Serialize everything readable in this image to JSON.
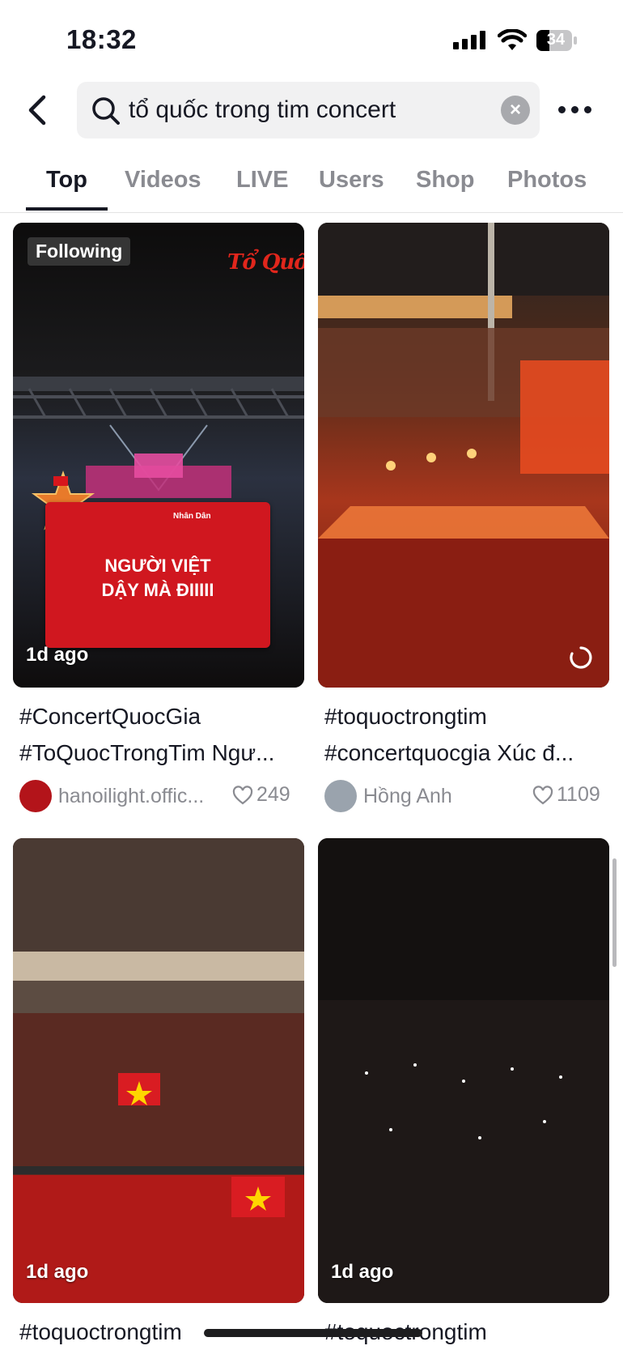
{
  "status_bar": {
    "time": "18:32",
    "battery": "34"
  },
  "search": {
    "query": "tổ quốc trong tim concert"
  },
  "tabs": [
    {
      "label": "Top"
    },
    {
      "label": "Videos"
    },
    {
      "label": "LIVE"
    },
    {
      "label": "Users"
    },
    {
      "label": "Shop"
    },
    {
      "label": "Photos"
    }
  ],
  "results": [
    {
      "badge": "Following",
      "overlay_logo": "Tổ Quốc",
      "card_line1": "NGƯỜI VIỆT",
      "card_line2": "DẬY MÀ ĐIIIII",
      "card_brand": "Nhân Dân",
      "age": "1d ago",
      "caption_line1": "#ConcertQuocGia",
      "caption_line2": "#ToQuocTrongTim Ngư...",
      "author": "hanoilight.offic...",
      "likes": "249"
    },
    {
      "age": "",
      "caption_line1": "#toquoctrongtim",
      "caption_line2": "#concertquocgia Xúc đ...",
      "author": "Hồng Anh",
      "likes": "1109"
    },
    {
      "age": "1d ago",
      "caption_line1": "#toquoctrongtim"
    },
    {
      "age": "1d ago",
      "caption_line1": "#toquoctrongtim"
    }
  ],
  "colors": {
    "accent": "#161823",
    "muted": "#8a8b91",
    "red": "#d4141c"
  }
}
